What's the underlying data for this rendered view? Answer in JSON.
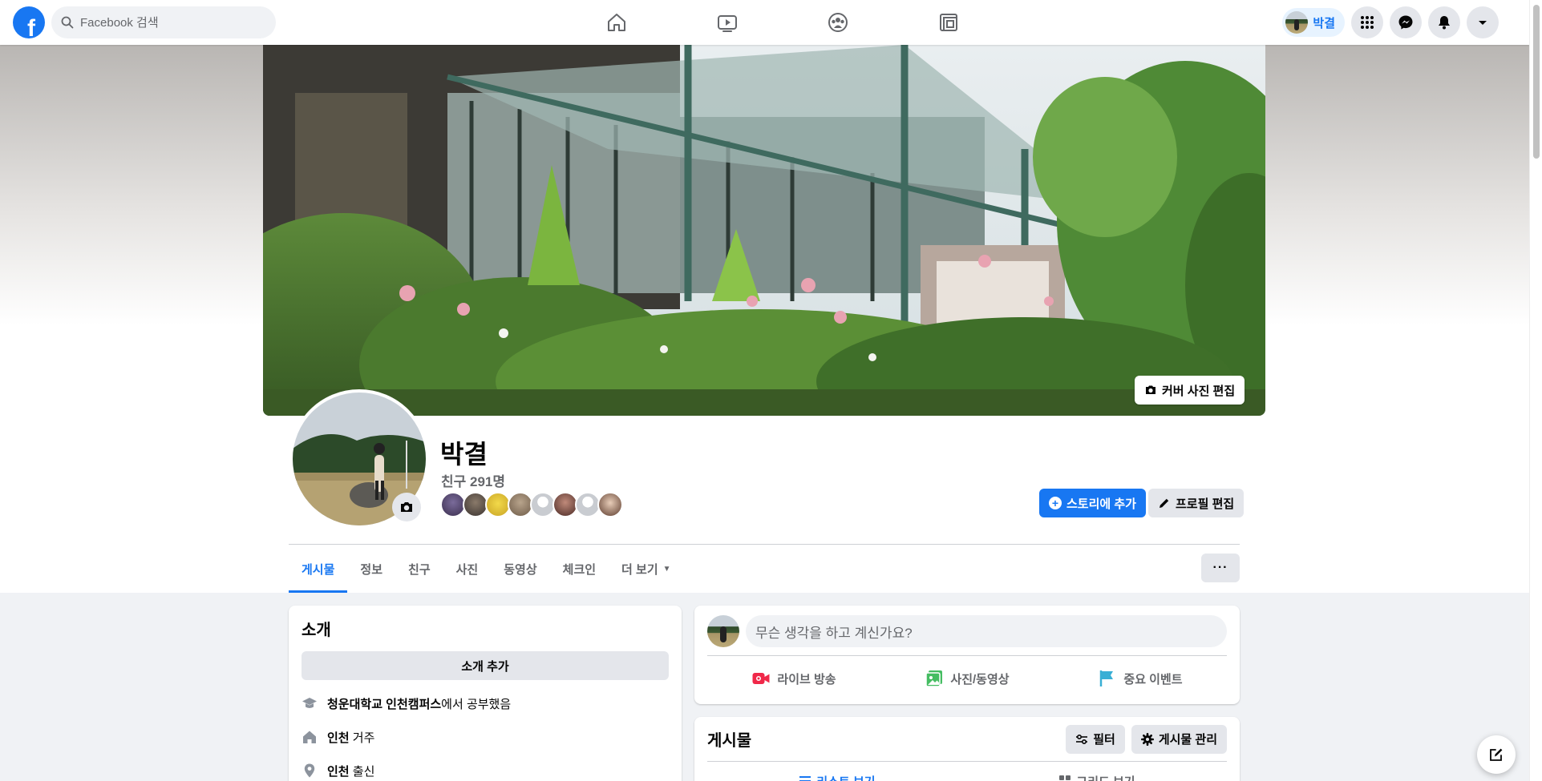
{
  "nav": {
    "logo": "f",
    "search_placeholder": "Facebook 검색",
    "icons": [
      "home-icon",
      "watch-icon",
      "groups-icon",
      "gaming-icon"
    ],
    "profile_chip_name": "박결",
    "right_icons": [
      "menu-grid-icon",
      "messenger-icon",
      "notifications-icon",
      "account-dropdown-icon"
    ],
    "brand_color": "#1877f2"
  },
  "cover": {
    "edit_label": "커버 사진 편집"
  },
  "profile": {
    "name": "박결",
    "friend_count": "친구 291명",
    "add_story_label": "스토리에 추가",
    "edit_profile_label": "프로필 편집"
  },
  "tabs": {
    "items": [
      {
        "label": "게시물",
        "active": true
      },
      {
        "label": "정보"
      },
      {
        "label": "친구"
      },
      {
        "label": "사진"
      },
      {
        "label": "동영상"
      },
      {
        "label": "체크인"
      },
      {
        "label": "더 보기"
      }
    ],
    "more_label": "···"
  },
  "intro": {
    "title": "소개",
    "add_label": "소개 추가",
    "rows": [
      {
        "icon": "education-icon",
        "bold": "청운대학교 인천캠퍼스",
        "text": "에서 공부했음"
      },
      {
        "icon": "home-icon",
        "bold": "인천",
        "text": " 거주"
      },
      {
        "icon": "location-pin-icon",
        "bold": "인천",
        "text": " 출신"
      }
    ]
  },
  "composer": {
    "placeholder": "무슨 생각을 하고 계신가요?",
    "actions": [
      {
        "label": "라이브 방송",
        "icon": "live-video-icon"
      },
      {
        "label": "사진/동영상",
        "icon": "photo-video-icon"
      },
      {
        "label": "중요 이벤트",
        "icon": "life-event-flag-icon"
      }
    ]
  },
  "posts": {
    "title": "게시물",
    "filter_label": "필터",
    "manage_label": "게시물 관리",
    "list_view_label": "리스트 보기",
    "grid_view_label": "그리드 보기"
  }
}
